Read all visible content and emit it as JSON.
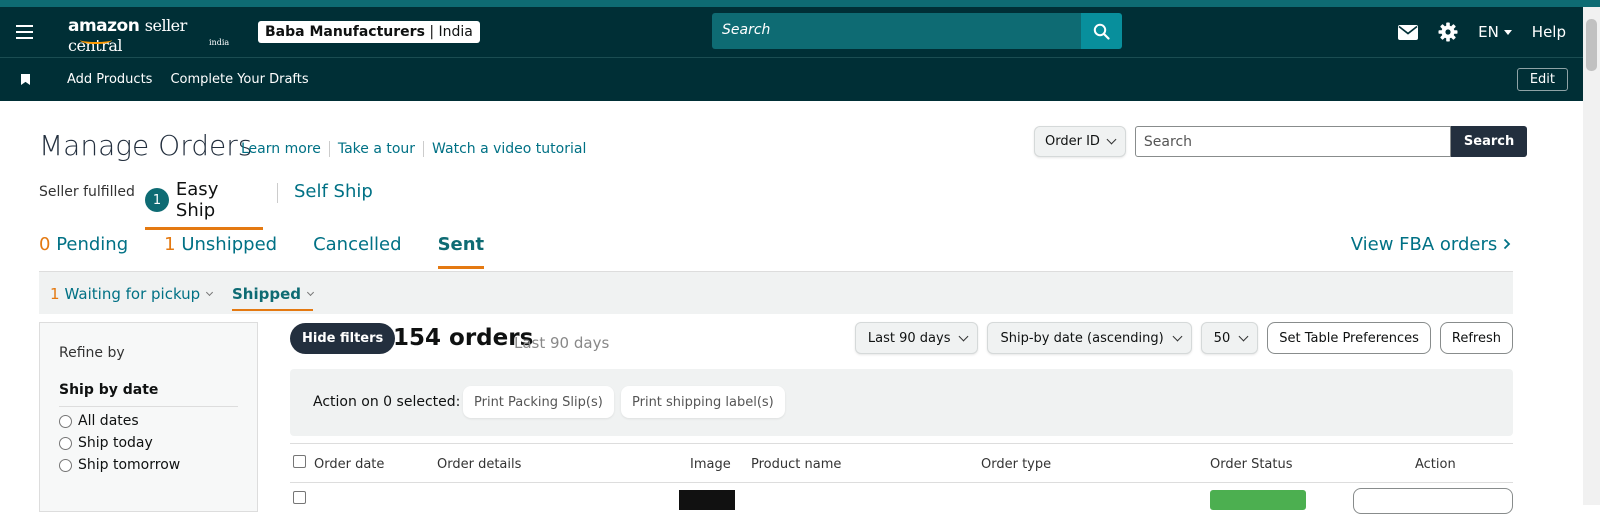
{
  "header": {
    "logo_main": "amazon",
    "logo_seller": "seller central",
    "logo_region": "india",
    "account_name": "Baba Manufacturers",
    "account_region": "India",
    "search_placeholder": "Search",
    "language": "EN",
    "help_label": "Help"
  },
  "nav": {
    "items": [
      "Add Products",
      "Complete Your Drafts"
    ],
    "edit_label": "Edit"
  },
  "page": {
    "title": "Manage Orders",
    "links": [
      "Learn more",
      "Take a tour",
      "Watch a video tutorial"
    ],
    "order_search": {
      "type_label": "Order ID",
      "placeholder": "Search",
      "button": "Search"
    },
    "fulfillment": {
      "label": "Seller fulfilled",
      "easy_ship_count": "1",
      "easy_ship": "Easy Ship",
      "self_ship": "Self Ship"
    },
    "tabs": [
      {
        "count": "0",
        "label": "Pending"
      },
      {
        "count": "1",
        "label": "Unshipped"
      },
      {
        "count": "",
        "label": "Cancelled"
      },
      {
        "count": "",
        "label": "Sent"
      }
    ],
    "view_fba": "View FBA orders",
    "subtabs": {
      "waiting_count": "1",
      "waiting_label": "Waiting for pickup",
      "shipped_label": "Shipped"
    }
  },
  "filters": {
    "refine_by": "Refine by",
    "ship_by_date": "Ship by date",
    "options": [
      "All dates",
      "Ship today",
      "Ship tomorrow"
    ]
  },
  "orders": {
    "hide_filters": "Hide filters",
    "count_label": "154 orders",
    "period_label": "Last 90 days",
    "date_range": "Last 90 days",
    "sort": "Ship-by date (ascending)",
    "page_size": "50",
    "table_prefs": "Set Table Preferences",
    "refresh": "Refresh",
    "action_label": "Action on 0 selected:",
    "print_packing": "Print Packing Slip(s)",
    "print_shipping": "Print shipping label(s)",
    "columns": [
      "Order date",
      "Order details",
      "Image",
      "Product name",
      "Order type",
      "Order Status",
      "Action"
    ]
  },
  "colors": {
    "header_bg": "#002f36",
    "accent_teal": "#0e6b73",
    "accent_orange": "#e47911",
    "link": "#007185"
  }
}
